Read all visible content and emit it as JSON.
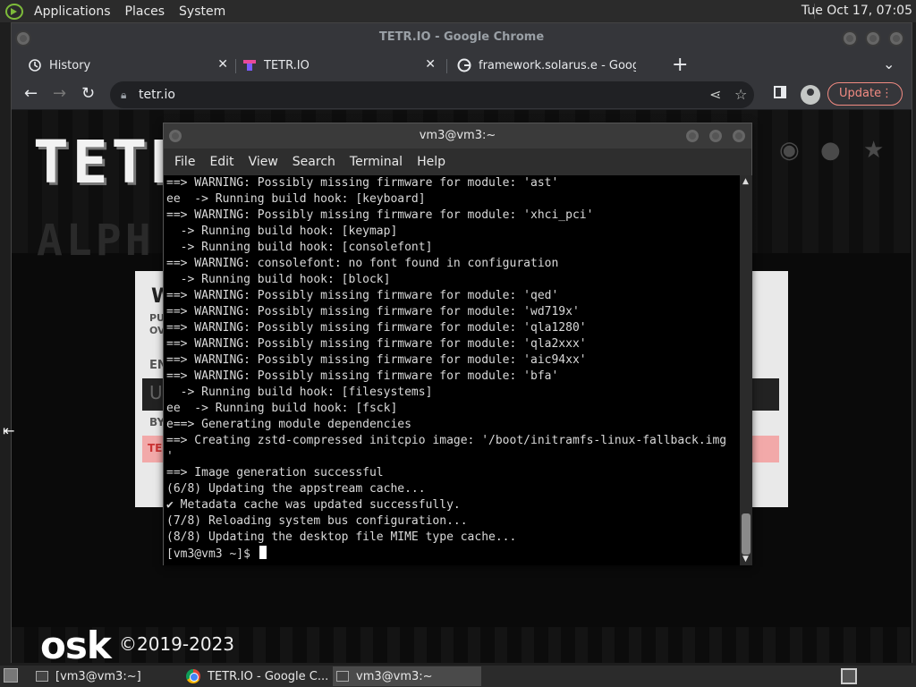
{
  "top_panel": {
    "menus": [
      "Applications",
      "Places",
      "System"
    ],
    "clock": "Tue Oct 17, 07:05"
  },
  "chrome": {
    "window_title": "TETR.IO - Google Chrome",
    "tabs": [
      {
        "label": "History",
        "icon": "history-icon"
      },
      {
        "label": "TETR.IO",
        "icon": "tetrio-favicon"
      },
      {
        "label": "framework.solarus.e - Google",
        "icon": "google-favicon"
      }
    ],
    "url": "tetr.io",
    "update_label": "Update"
  },
  "page": {
    "logo_text": "TETR",
    "alpha_text": "ALPH",
    "panel_heading": "W",
    "panel_line1": "PU",
    "panel_line2": "OV",
    "panel_enter": "EN",
    "panel_input_char": "U",
    "panel_by": "BY",
    "panel_button_text": "TE",
    "osk_logo": "osk",
    "copyright": "©2019-2023"
  },
  "terminal": {
    "title": "vm3@vm3:~",
    "menus": [
      "File",
      "Edit",
      "View",
      "Search",
      "Terminal",
      "Help"
    ],
    "lines": [
      "==> WARNING: Possibly missing firmware for module: 'ast'",
      "ee  -> Running build hook: [keyboard]",
      "==> WARNING: Possibly missing firmware for module: 'xhci_pci'",
      "  -> Running build hook: [keymap]",
      "  -> Running build hook: [consolefont]",
      "==> WARNING: consolefont: no font found in configuration",
      "  -> Running build hook: [block]",
      "==> WARNING: Possibly missing firmware for module: 'qed'",
      "==> WARNING: Possibly missing firmware for module: 'wd719x'",
      "==> WARNING: Possibly missing firmware for module: 'qla1280'",
      "==> WARNING: Possibly missing firmware for module: 'qla2xxx'",
      "==> WARNING: Possibly missing firmware for module: 'aic94xx'",
      "==> WARNING: Possibly missing firmware for module: 'bfa'",
      "  -> Running build hook: [filesystems]",
      "ee  -> Running build hook: [fsck]",
      "e==> Generating module dependencies",
      "==> Creating zstd-compressed initcpio image: '/boot/initramfs-linux-fallback.img",
      "'",
      "==> Image generation successful",
      "(6/8) Updating the appstream cache...",
      "✔ Metadata cache was updated successfully.",
      "(7/8) Reloading system bus configuration...",
      "(8/8) Updating the desktop file MIME type cache..."
    ],
    "prompt": "[vm3@vm3 ~]$ "
  },
  "taskbar": {
    "items": [
      {
        "label": "[vm3@vm3:~]",
        "icon": "terminal-icon"
      },
      {
        "label": "TETR.IO - Google C...",
        "icon": "chrome-icon"
      },
      {
        "label": "vm3@vm3:~",
        "icon": "terminal-icon"
      }
    ]
  }
}
